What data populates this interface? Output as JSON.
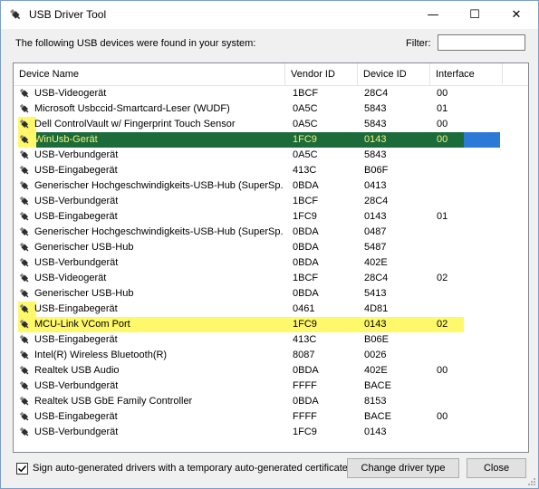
{
  "window": {
    "title": "USB Driver Tool",
    "minimize_glyph": "—",
    "maximize_glyph": "☐",
    "close_glyph": "✕"
  },
  "intro": {
    "text": "The following USB devices were found in your system:",
    "filter_label": "Filter:",
    "filter_value": ""
  },
  "columns": [
    "Device Name",
    "Vendor ID",
    "Device ID",
    "Interface"
  ],
  "rows": [
    {
      "name": "USB-Videogerät",
      "vendor": "1BCF",
      "device": "28C4",
      "iface": "00",
      "highlight": "none"
    },
    {
      "name": "Microsoft Usbccid-Smartcard-Leser (WUDF)",
      "vendor": "0A5C",
      "device": "5843",
      "iface": "01",
      "highlight": "none"
    },
    {
      "name": "Dell ControlVault w/ Fingerprint Touch Sensor",
      "vendor": "0A5C",
      "device": "5843",
      "iface": "00",
      "highlight": "icon"
    },
    {
      "name": "WinUsb-Gerät",
      "vendor": "1FC9",
      "device": "0143",
      "iface": "00",
      "highlight": "selected"
    },
    {
      "name": "USB-Verbundgerät",
      "vendor": "0A5C",
      "device": "5843",
      "iface": "",
      "highlight": "none"
    },
    {
      "name": "USB-Eingabegerät",
      "vendor": "413C",
      "device": "B06F",
      "iface": "",
      "highlight": "none"
    },
    {
      "name": "Generischer Hochgeschwindigkeits-USB-Hub (SuperSp...",
      "vendor": "0BDA",
      "device": "0413",
      "iface": "",
      "highlight": "none"
    },
    {
      "name": "USB-Verbundgerät",
      "vendor": "1BCF",
      "device": "28C4",
      "iface": "",
      "highlight": "none"
    },
    {
      "name": "USB-Eingabegerät",
      "vendor": "1FC9",
      "device": "0143",
      "iface": "01",
      "highlight": "none"
    },
    {
      "name": "Generischer Hochgeschwindigkeits-USB-Hub (SuperSp...",
      "vendor": "0BDA",
      "device": "0487",
      "iface": "",
      "highlight": "none"
    },
    {
      "name": "Generischer USB-Hub",
      "vendor": "0BDA",
      "device": "5487",
      "iface": "",
      "highlight": "none"
    },
    {
      "name": "USB-Verbundgerät",
      "vendor": "0BDA",
      "device": "402E",
      "iface": "",
      "highlight": "none"
    },
    {
      "name": "USB-Videogerät",
      "vendor": "1BCF",
      "device": "28C4",
      "iface": "02",
      "highlight": "none"
    },
    {
      "name": "Generischer USB-Hub",
      "vendor": "0BDA",
      "device": "5413",
      "iface": "",
      "highlight": "none"
    },
    {
      "name": "USB-Eingabegerät",
      "vendor": "0461",
      "device": "4D81",
      "iface": "",
      "highlight": "icon"
    },
    {
      "name": "MCU-Link VCom Port",
      "vendor": "1FC9",
      "device": "0143",
      "iface": "02",
      "highlight": "yellow"
    },
    {
      "name": "USB-Eingabegerät",
      "vendor": "413C",
      "device": "B06E",
      "iface": "",
      "highlight": "none"
    },
    {
      "name": "Intel(R) Wireless Bluetooth(R)",
      "vendor": "8087",
      "device": "0026",
      "iface": "",
      "highlight": "none"
    },
    {
      "name": "Realtek USB Audio",
      "vendor": "0BDA",
      "device": "402E",
      "iface": "00",
      "highlight": "none"
    },
    {
      "name": "USB-Verbundgerät",
      "vendor": "FFFF",
      "device": "BACE",
      "iface": "",
      "highlight": "none"
    },
    {
      "name": "Realtek USB GbE Family Controller",
      "vendor": "0BDA",
      "device": "8153",
      "iface": "",
      "highlight": "none"
    },
    {
      "name": "USB-Eingabegerät",
      "vendor": "FFFF",
      "device": "BACE",
      "iface": "00",
      "highlight": "none"
    },
    {
      "name": "USB-Verbundgerät",
      "vendor": "1FC9",
      "device": "0143",
      "iface": "",
      "highlight": "none"
    }
  ],
  "footer": {
    "sign_checked": true,
    "sign_label": "Sign auto-generated drivers with a temporary auto-generated certificate",
    "change_button": "Change driver type",
    "close_button": "Close"
  },
  "colors": {
    "highlight_yellow": "#fff86a",
    "selected_green": "#1c6b3a",
    "selected_blue": "#2c7ad6",
    "selected_text": "#f4f27a"
  }
}
